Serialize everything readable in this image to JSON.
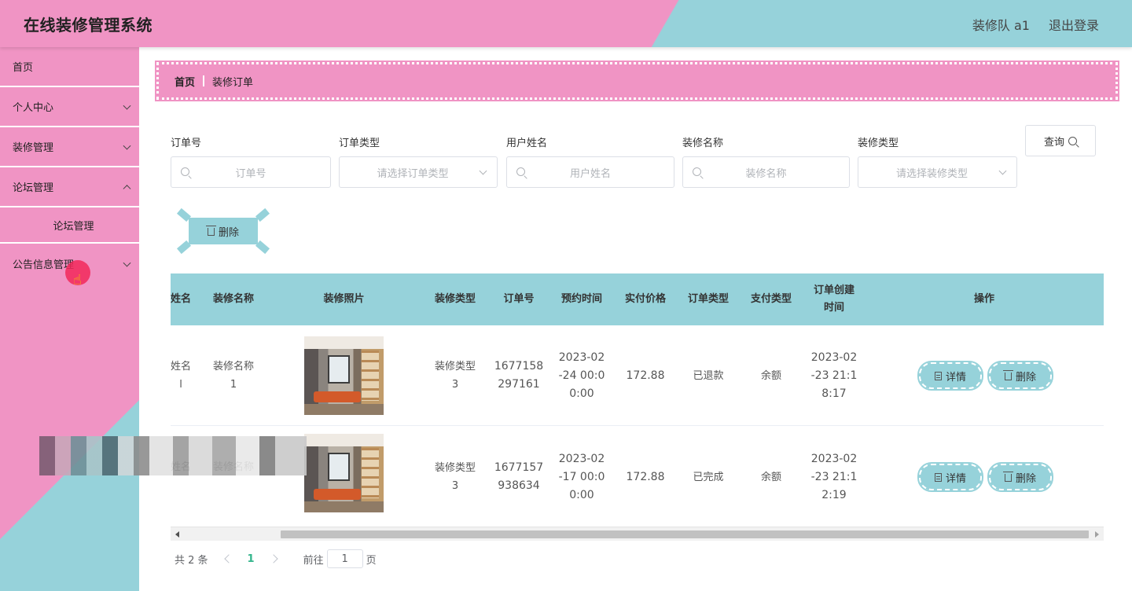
{
  "header": {
    "title": "在线装修管理系统",
    "user": "装修队 a1",
    "logout": "退出登录"
  },
  "sidebar": {
    "items": [
      {
        "label": "首页"
      },
      {
        "label": "个人中心"
      },
      {
        "label": "装修管理"
      },
      {
        "label": "论坛管理"
      },
      {
        "label": "论坛管理"
      },
      {
        "label": "公告信息管理"
      }
    ]
  },
  "breadcrumb": {
    "home": "首页",
    "current": "装修订单"
  },
  "filters": {
    "order_no": {
      "label": "订单号",
      "placeholder": "订单号"
    },
    "order_type": {
      "label": "订单类型",
      "placeholder": "请选择订单类型"
    },
    "user_name": {
      "label": "用户姓名",
      "placeholder": "用户姓名"
    },
    "reno_name": {
      "label": "装修名称",
      "placeholder": "装修名称"
    },
    "reno_type": {
      "label": "装修类型",
      "placeholder": "请选择装修类型"
    },
    "query_label": "查询"
  },
  "toolbar": {
    "delete_label": "删除"
  },
  "table": {
    "columns": [
      "姓名",
      "装修名称",
      "装修照片",
      "装修类型",
      "订单号",
      "预约时间",
      "实付价格",
      "订单类型",
      "支付类型",
      "订单创建时间",
      "操作"
    ],
    "rows": [
      {
        "name": "姓名 l",
        "reno_name": "装修名称 1",
        "reno_type": "装修类型 3",
        "order_no": "1677158 297161",
        "appt": "2023-02 -24 00:0 0:00",
        "price": "172.88",
        "order_type": "已退款",
        "pay_type": "余额",
        "created": "2023-02 -23 21:1 8:17",
        "detail": "详情",
        "delete": "删除"
      },
      {
        "name": "姓名",
        "reno_name": "装修名称",
        "reno_type": "装修类型 3",
        "order_no": "1677157 938634",
        "appt": "2023-02 -17 00:0 0:00",
        "price": "172.88",
        "order_type": "已完成",
        "pay_type": "余额",
        "created": "2023-02 -23 21:1 2:19",
        "detail": "详情",
        "delete": "删除"
      }
    ]
  },
  "pagination": {
    "total": "共 2 条",
    "current": "1",
    "goto_prefix": "前往",
    "goto_value": "1",
    "goto_suffix": "页"
  },
  "colors": {
    "pink": "#f094c4",
    "teal": "#96d2da",
    "active_page": "#34b58c"
  }
}
